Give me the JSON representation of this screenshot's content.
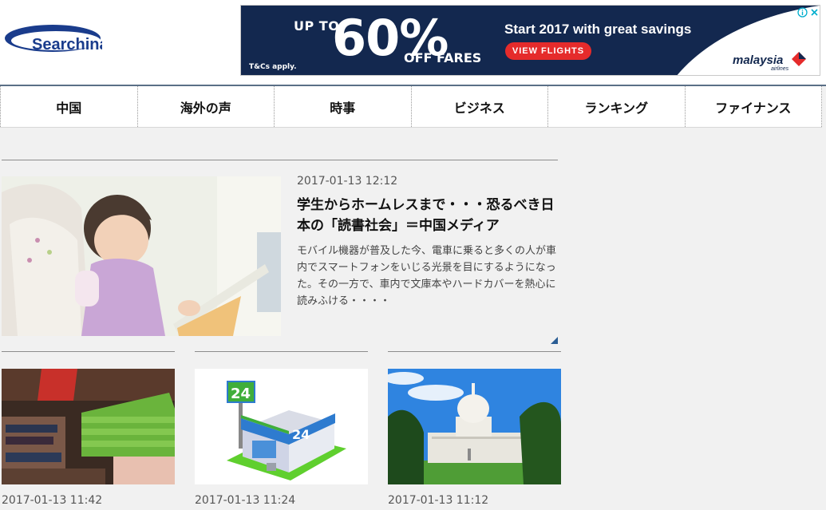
{
  "logo": {
    "text": "Searchina"
  },
  "ad": {
    "up_to": "UP TO",
    "percent": "60%",
    "off": "OFF FARES",
    "tcs": "T&Cs apply.",
    "headline": "Start 2017 with great savings",
    "button": "VIEW FLIGHTS",
    "brand": "malaysia",
    "brand_sub": "airlines",
    "colors": {
      "background": "#13284f",
      "button": "#e52b2b"
    }
  },
  "nav": {
    "items": [
      {
        "label": "中国"
      },
      {
        "label": "海外の声"
      },
      {
        "label": "時事"
      },
      {
        "label": "ビジネス"
      },
      {
        "label": "ランキング"
      },
      {
        "label": "ファイナンス"
      }
    ]
  },
  "featured": {
    "date": "2017-01-13 12:12",
    "title": "学生からホームレスまで・・・恐るべき日本の「読書社会」＝中国メディア",
    "summary": "モバイル機器が普及した今、電車に乗ると多くの人が車内でスマートフォンをいじる光景を目にするようになった。その一方で、車内で文庫本やハードカバーを熱心に読みふける・・・・"
  },
  "cards": [
    {
      "date": "2017-01-13 11:42"
    },
    {
      "date": "2017-01-13 11:24"
    },
    {
      "date": "2017-01-13 11:12"
    }
  ]
}
